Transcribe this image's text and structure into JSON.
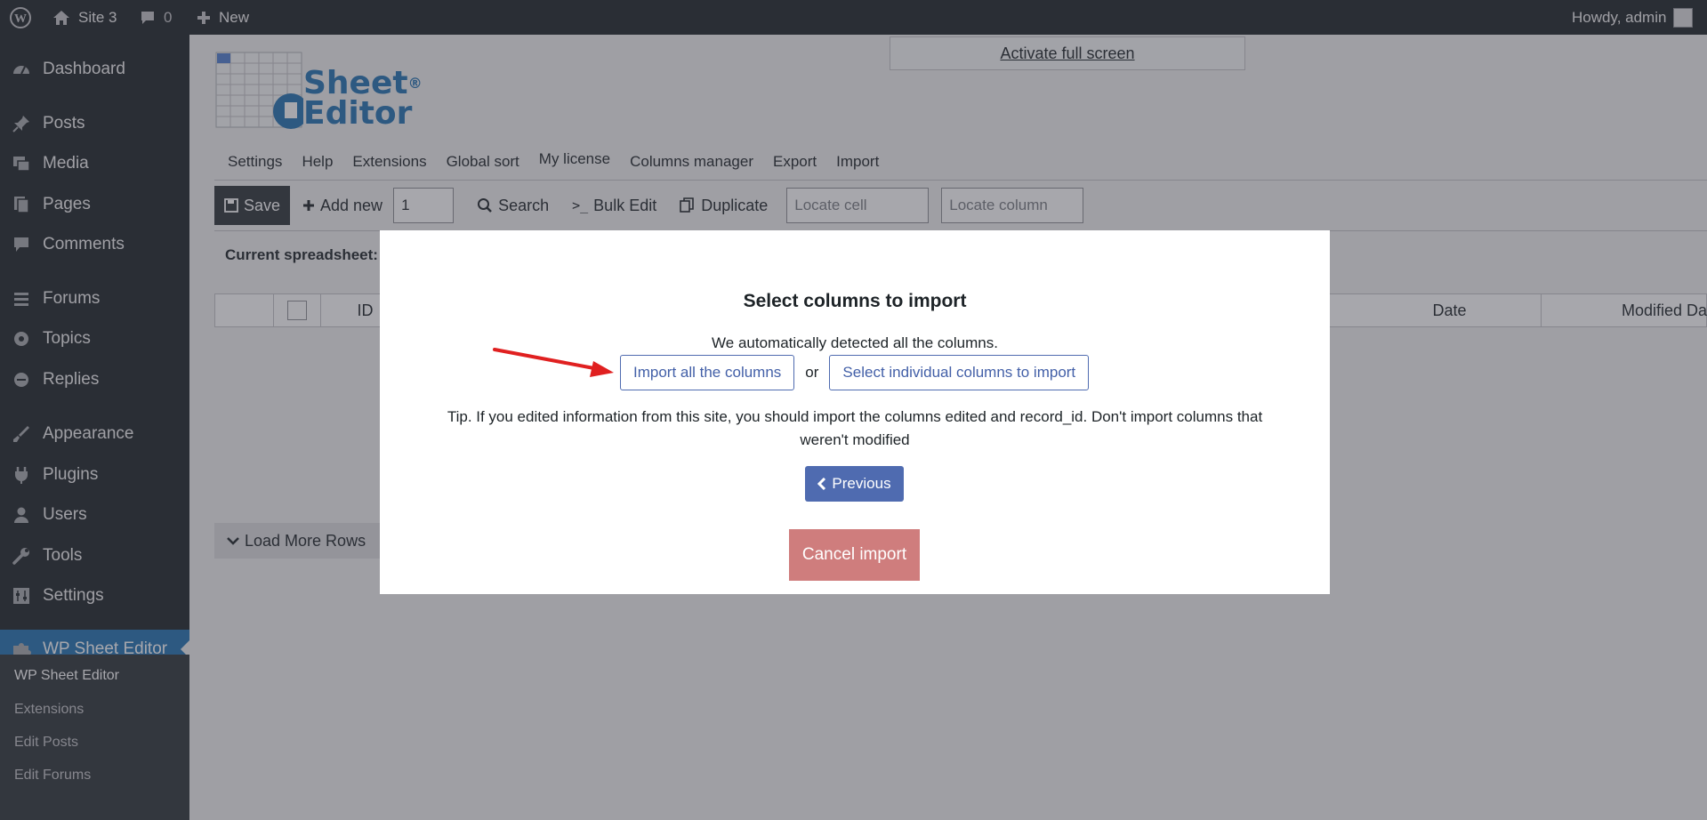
{
  "admin_bar": {
    "site_name": "Site 3",
    "comments_count": "0",
    "new_label": "New",
    "howdy": "Howdy, admin"
  },
  "sidebar": {
    "items": [
      {
        "label": "Dashboard",
        "icon": "dashboard-icon"
      },
      {
        "label": "Posts",
        "icon": "pin-icon"
      },
      {
        "label": "Media",
        "icon": "media-icon"
      },
      {
        "label": "Pages",
        "icon": "pages-icon"
      },
      {
        "label": "Comments",
        "icon": "comment-icon"
      },
      {
        "label": "Forums",
        "icon": "forums-icon"
      },
      {
        "label": "Topics",
        "icon": "topics-icon"
      },
      {
        "label": "Replies",
        "icon": "replies-icon"
      },
      {
        "label": "Appearance",
        "icon": "brush-icon"
      },
      {
        "label": "Plugins",
        "icon": "plug-icon"
      },
      {
        "label": "Users",
        "icon": "user-icon"
      },
      {
        "label": "Tools",
        "icon": "wrench-icon"
      },
      {
        "label": "Settings",
        "icon": "settings-icon"
      },
      {
        "label": "WP Sheet Editor",
        "icon": "puzzle-icon"
      }
    ],
    "submenu": [
      "WP Sheet Editor",
      "Extensions",
      "Edit Posts",
      "Edit Forums"
    ]
  },
  "main": {
    "fullscreen_link": "Activate full screen",
    "logo": {
      "word1": "Sheet",
      "word2": "Editor",
      "reg": "®"
    },
    "nav_tabs": [
      "Settings",
      "Help",
      "Extensions",
      "Global sort",
      "My license",
      "Columns manager",
      "Export",
      "Import"
    ],
    "toolbar": {
      "save": "Save",
      "add_new": "Add new",
      "add_count": "1",
      "search": "Search",
      "bulk_edit": "Bulk Edit",
      "duplicate": "Duplicate",
      "locate_cell": "Locate cell",
      "locate_column": "Locate column"
    },
    "current_spreadsheet": "Current spreadsheet:",
    "grid_headers": {
      "id": "ID",
      "date": "Date",
      "modified": "Modified Da"
    },
    "load_more": "Load More Rows"
  },
  "modal": {
    "title": "Select columns to import",
    "detected": "We automatically detected all the columns.",
    "import_all": "Import all the columns",
    "or": "or",
    "select_individual": "Select individual columns to import",
    "tip": "Tip. If you edited information from this site, you should import the columns edited and record_id. Don't import columns that weren't modified",
    "previous": "Previous",
    "cancel": "Cancel import"
  },
  "colors": {
    "admin_dark": "#1d2327",
    "wp_blue": "#2271b1",
    "button_blue": "#4f6bb0",
    "cancel_red": "#cf7d7d",
    "annotation_arrow": "#e02020"
  }
}
